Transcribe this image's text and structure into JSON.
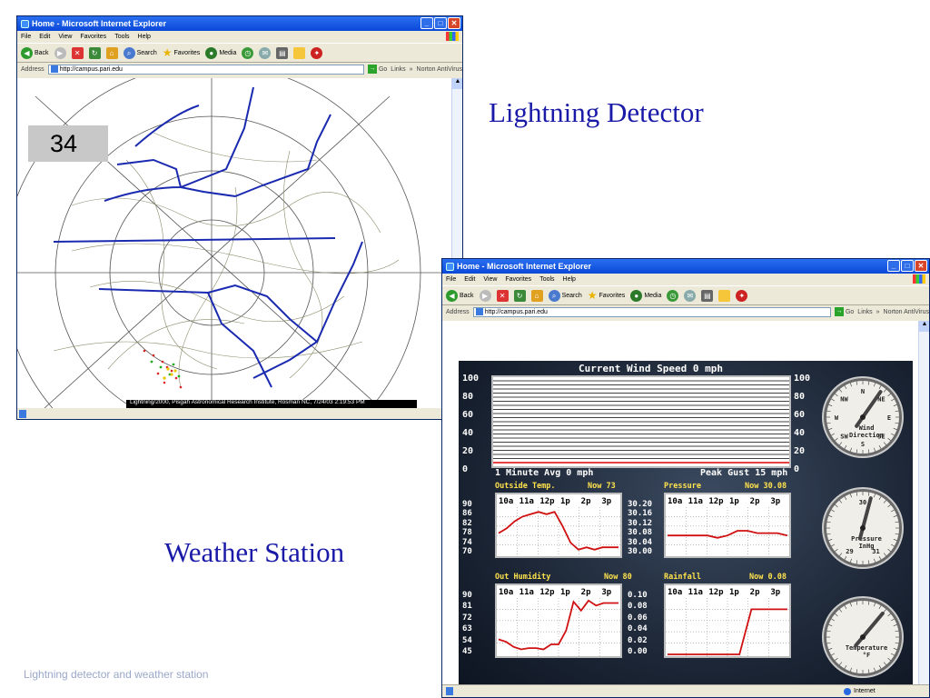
{
  "slide": {
    "title_lightning": "Lightning Detector",
    "title_weather": "Weather Station",
    "footer": "Lightning detector and weather station"
  },
  "browser": {
    "title": "Home - Microsoft Internet Explorer",
    "menu": [
      "File",
      "Edit",
      "View",
      "Favorites",
      "Tools",
      "Help"
    ],
    "toolbar": {
      "back": "Back",
      "search": "Search",
      "favorites": "Favorites",
      "media": "Media"
    },
    "address_label": "Address",
    "url": "http://campus.pari.edu",
    "go": "Go",
    "links": "Links",
    "chevron": "»",
    "norton": "Norton AntiVirus",
    "status_zone": "Internet"
  },
  "lightning": {
    "counter": "34",
    "caption": "Lightning/2000, Pisgah Astronomical Research Institute, Rosman NC, 7/24/03 2:19:53 PM"
  },
  "weather": {
    "wind_title": "Current Wind Speed 0 mph",
    "wind_avg": "1 Minute Avg 0 mph",
    "wind_gust": "Peak Gust 15 mph",
    "wind_axis": [
      "100",
      "80",
      "60",
      "40",
      "20",
      "0"
    ],
    "outside_temp": {
      "label": "Outside Temp.",
      "now": "Now 73",
      "axis": [
        "90",
        "86",
        "82",
        "78",
        "74",
        "70"
      ]
    },
    "pressure": {
      "label": "Pressure",
      "now": "Now 30.08",
      "axis": [
        "30.20",
        "30.16",
        "30.12",
        "30.08",
        "30.04",
        "30.00"
      ]
    },
    "humidity": {
      "label": "Out Humidity",
      "now": "Now 80",
      "axis": [
        "90",
        "81",
        "72",
        "63",
        "54",
        "45"
      ]
    },
    "rainfall": {
      "label": "Rainfall",
      "now": "Now 0.08",
      "axis": [
        "0.10",
        "0.08",
        "0.06",
        "0.04",
        "0.02",
        "0.00"
      ]
    },
    "time_labels": [
      "10a",
      "11a",
      "12p",
      "1p",
      "2p",
      "3p"
    ],
    "gauge_wind": {
      "label1": "Wind",
      "label2": "Direction",
      "dirs": [
        "N",
        "NE",
        "E",
        "SE",
        "S",
        "SW",
        "W",
        "NW"
      ]
    },
    "gauge_pressure": {
      "label1": "Pressure",
      "label2": "InHg",
      "marks": [
        "30",
        "29",
        "31"
      ]
    },
    "gauge_temp": {
      "label1": "Temperature",
      "label2": "°F"
    }
  },
  "chart_data": [
    {
      "type": "line",
      "title": "Outside Temp.",
      "x": [
        "10a",
        "11a",
        "12p",
        "1p",
        "2p",
        "3p"
      ],
      "ylim": [
        70,
        90
      ],
      "values": [
        79,
        81,
        84,
        86,
        87,
        88,
        87,
        88,
        82,
        75,
        72,
        73,
        72,
        73,
        73,
        73
      ]
    },
    {
      "type": "line",
      "title": "Pressure",
      "x": [
        "10a",
        "11a",
        "12p",
        "1p",
        "2p",
        "3p"
      ],
      "ylim": [
        30.0,
        30.2
      ],
      "values": [
        30.08,
        30.08,
        30.08,
        30.08,
        30.08,
        30.07,
        30.08,
        30.1,
        30.1,
        30.09,
        30.09,
        30.09,
        30.08
      ]
    },
    {
      "type": "line",
      "title": "Out Humidity",
      "x": [
        "10a",
        "11a",
        "12p",
        "1p",
        "2p",
        "3p"
      ],
      "ylim": [
        45,
        90
      ],
      "values": [
        57,
        55,
        51,
        49,
        50,
        50,
        49,
        53,
        53,
        64,
        87,
        80,
        88,
        84,
        86,
        86,
        86
      ]
    },
    {
      "type": "line",
      "title": "Rainfall",
      "x": [
        "10a",
        "11a",
        "12p",
        "1p",
        "2p",
        "3p"
      ],
      "ylim": [
        0.0,
        0.1
      ],
      "values": [
        0,
        0,
        0,
        0,
        0,
        0,
        0,
        0.08,
        0.08,
        0.08,
        0.08
      ]
    },
    {
      "type": "bar",
      "title": "Current Wind Speed 0 mph",
      "ylim": [
        0,
        100
      ],
      "values": [
        0
      ]
    }
  ]
}
